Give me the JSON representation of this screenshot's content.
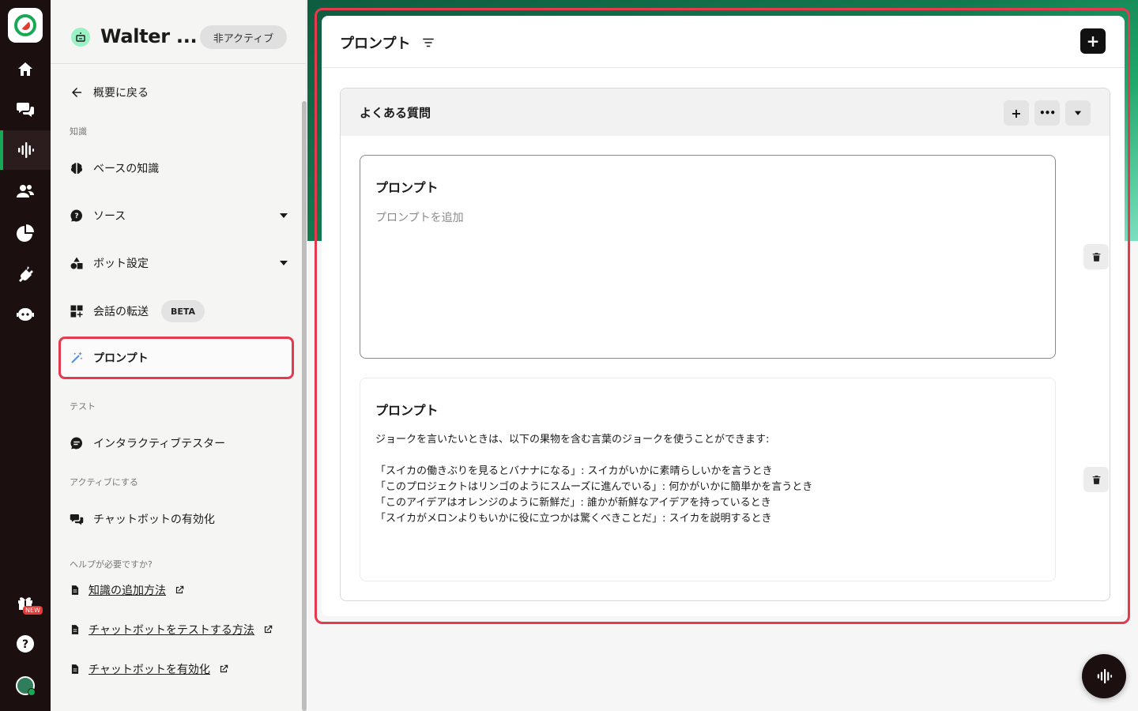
{
  "app": {
    "bot_name": "Walter ...",
    "status": "非アクティブ"
  },
  "rail": {
    "items": [
      "home-icon",
      "chat-icon",
      "voice-icon",
      "users-icon",
      "analytics-icon",
      "plugin-icon",
      "bot-icon"
    ],
    "active": "voice-icon",
    "new_badge": "NEW",
    "help": "?"
  },
  "sidebar": {
    "back_label": "概要に戻る",
    "section_knowledge": "知識",
    "knowledge_base": "ベースの知識",
    "sources": "ソース",
    "bot_settings": "ボット設定",
    "transfer": "会話の転送",
    "beta": "BETA",
    "prompt": "プロンプト",
    "section_test": "テスト",
    "interactive_tester": "インタラクティブテスター",
    "section_activate": "アクティブにする",
    "activate_chatbot": "チャットボットの有効化",
    "section_help": "ヘルプが必要ですか?",
    "help_links": [
      "知識の追加方法",
      "チャットボットをテストする方法",
      "チャットボットを有効化"
    ]
  },
  "main": {
    "title": "プロンプト",
    "add_button": "+",
    "group": {
      "title": "よくある質問",
      "add": "+",
      "more": "•••"
    },
    "cards": [
      {
        "title": "プロンプト",
        "placeholder": "プロンプトを追加",
        "body": ""
      },
      {
        "title": "プロンプト",
        "placeholder": "",
        "body": "ジョークを言いたいときは、以下の果物を含む言葉のジョークを使うことができます:\n\n「スイカの働きぶりを見るとバナナになる」: スイカがいかに素晴らしいかを言うとき\n「このプロジェクトはリンゴのようにスムーズに進んでいる」: 何かがいかに簡単かを言うとき\n「このアイデアはオレンジのように新鮮だ」: 誰かが新鮮なアイデアを持っているとき\n「スイカがメロンよりもいかに役に立つかは驚くべきことだ」: スイカを説明するとき"
      }
    ]
  },
  "colors": {
    "rail_bg": "#1b0f0f",
    "accent_green": "#18a957",
    "highlight_red": "#e53950"
  }
}
